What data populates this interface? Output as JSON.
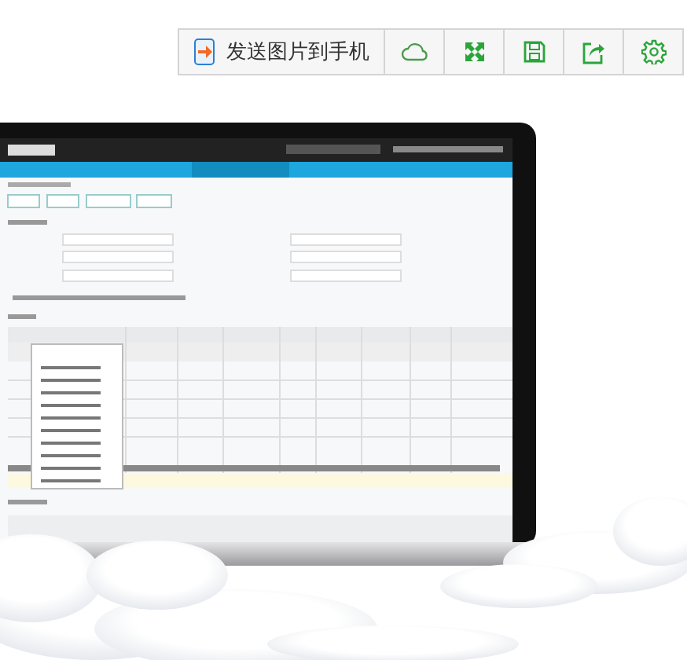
{
  "toolbar": {
    "buttons": [
      {
        "kind": "send",
        "label": "发送图片到手机"
      },
      {
        "kind": "cloud"
      },
      {
        "kind": "fullscreen"
      },
      {
        "kind": "save"
      },
      {
        "kind": "share"
      },
      {
        "kind": "settings"
      }
    ]
  }
}
